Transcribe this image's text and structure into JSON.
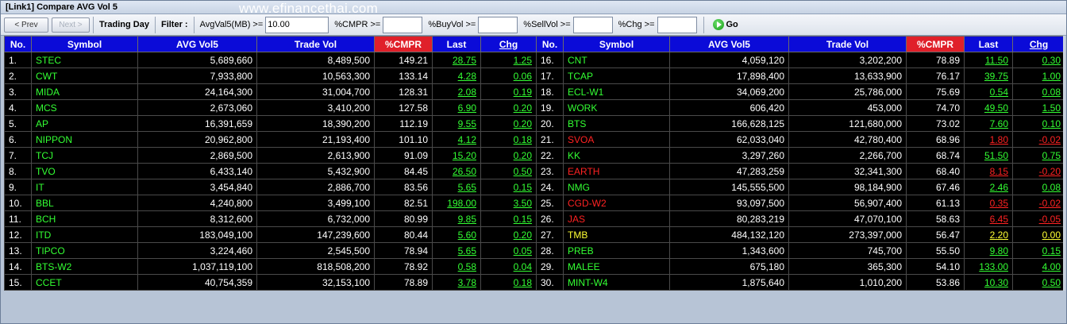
{
  "title": "[Link1] Compare AVG Vol 5",
  "watermark": "www.efinancethai.com",
  "toolbar": {
    "prev_label": "< Prev",
    "next_label": "Next >",
    "trading_day": "Trading Day",
    "filter_label": "Filter :",
    "avgvol_label": "AvgVal5(MB) >=",
    "avgvol_value": "10.00",
    "cmpr_label": "%CMPR >=",
    "cmpr_value": "",
    "buyvol_label": "%BuyVol >=",
    "buyvol_value": "",
    "sellvol_label": "%SellVol >=",
    "sellvol_value": "",
    "chg_label": "%Chg >=",
    "chg_value": "",
    "go_label": "Go"
  },
  "headers": [
    "No.",
    "Symbol",
    "AVG Vol5",
    "Trade Vol",
    "%CMPR",
    "Last",
    "Chg"
  ],
  "colors": {
    "header_bg": "#0b0bd8",
    "cmpr_bg": "#e0202a",
    "up": "#33ff33",
    "down": "#ff2222",
    "flat": "#ffff33"
  },
  "rows": [
    {
      "no": "1.",
      "sym": "STEC",
      "avg": "5,689,660",
      "vol": "8,489,500",
      "cmpr": "149.21",
      "last": "28.75",
      "chg": "1.25",
      "c": "g"
    },
    {
      "no": "2.",
      "sym": "CWT",
      "avg": "7,933,800",
      "vol": "10,563,300",
      "cmpr": "133.14",
      "last": "4.28",
      "chg": "0.06",
      "c": "g"
    },
    {
      "no": "3.",
      "sym": "MIDA",
      "avg": "24,164,300",
      "vol": "31,004,700",
      "cmpr": "128.31",
      "last": "2.08",
      "chg": "0.19",
      "c": "g"
    },
    {
      "no": "4.",
      "sym": "MCS",
      "avg": "2,673,060",
      "vol": "3,410,200",
      "cmpr": "127.58",
      "last": "6.90",
      "chg": "0.20",
      "c": "g"
    },
    {
      "no": "5.",
      "sym": "AP",
      "avg": "16,391,659",
      "vol": "18,390,200",
      "cmpr": "112.19",
      "last": "9.55",
      "chg": "0.20",
      "c": "g"
    },
    {
      "no": "6.",
      "sym": "NIPPON",
      "avg": "20,962,800",
      "vol": "21,193,400",
      "cmpr": "101.10",
      "last": "4.12",
      "chg": "0.18",
      "c": "g"
    },
    {
      "no": "7.",
      "sym": "TCJ",
      "avg": "2,869,500",
      "vol": "2,613,900",
      "cmpr": "91.09",
      "last": "15.20",
      "chg": "0.20",
      "c": "g"
    },
    {
      "no": "8.",
      "sym": "TVO",
      "avg": "6,433,140",
      "vol": "5,432,900",
      "cmpr": "84.45",
      "last": "26.50",
      "chg": "0.50",
      "c": "g"
    },
    {
      "no": "9.",
      "sym": "IT",
      "avg": "3,454,840",
      "vol": "2,886,700",
      "cmpr": "83.56",
      "last": "5.65",
      "chg": "0.15",
      "c": "g"
    },
    {
      "no": "10.",
      "sym": "BBL",
      "avg": "4,240,800",
      "vol": "3,499,100",
      "cmpr": "82.51",
      "last": "198.00",
      "chg": "3.50",
      "c": "g"
    },
    {
      "no": "11.",
      "sym": "BCH",
      "avg": "8,312,600",
      "vol": "6,732,000",
      "cmpr": "80.99",
      "last": "9.85",
      "chg": "0.15",
      "c": "g"
    },
    {
      "no": "12.",
      "sym": "ITD",
      "avg": "183,049,100",
      "vol": "147,239,600",
      "cmpr": "80.44",
      "last": "5.60",
      "chg": "0.20",
      "c": "g"
    },
    {
      "no": "13.",
      "sym": "TIPCO",
      "avg": "3,224,460",
      "vol": "2,545,500",
      "cmpr": "78.94",
      "last": "5.65",
      "chg": "0.05",
      "c": "g"
    },
    {
      "no": "14.",
      "sym": "BTS-W2",
      "avg": "1,037,119,100",
      "vol": "818,508,200",
      "cmpr": "78.92",
      "last": "0.58",
      "chg": "0.04",
      "c": "g"
    },
    {
      "no": "15.",
      "sym": "CCET",
      "avg": "40,754,359",
      "vol": "32,153,100",
      "cmpr": "78.89",
      "last": "3.78",
      "chg": "0.18",
      "c": "g"
    }
  ],
  "rows2": [
    {
      "no": "16.",
      "sym": "CNT",
      "avg": "4,059,120",
      "vol": "3,202,200",
      "cmpr": "78.89",
      "last": "11.50",
      "chg": "0.30",
      "c": "g"
    },
    {
      "no": "17.",
      "sym": "TCAP",
      "avg": "17,898,400",
      "vol": "13,633,900",
      "cmpr": "76.17",
      "last": "39.75",
      "chg": "1.00",
      "c": "g"
    },
    {
      "no": "18.",
      "sym": "ECL-W1",
      "avg": "34,069,200",
      "vol": "25,786,000",
      "cmpr": "75.69",
      "last": "0.54",
      "chg": "0.08",
      "c": "g"
    },
    {
      "no": "19.",
      "sym": "WORK",
      "avg": "606,420",
      "vol": "453,000",
      "cmpr": "74.70",
      "last": "49.50",
      "chg": "1.50",
      "c": "g"
    },
    {
      "no": "20.",
      "sym": "BTS",
      "avg": "166,628,125",
      "vol": "121,680,000",
      "cmpr": "73.02",
      "last": "7.60",
      "chg": "0.10",
      "c": "g"
    },
    {
      "no": "21.",
      "sym": "SVOA",
      "avg": "62,033,040",
      "vol": "42,780,400",
      "cmpr": "68.96",
      "last": "1.80",
      "chg": "-0.02",
      "c": "r"
    },
    {
      "no": "22.",
      "sym": "KK",
      "avg": "3,297,260",
      "vol": "2,266,700",
      "cmpr": "68.74",
      "last": "51.50",
      "chg": "0.75",
      "c": "g"
    },
    {
      "no": "23.",
      "sym": "EARTH",
      "avg": "47,283,259",
      "vol": "32,341,300",
      "cmpr": "68.40",
      "last": "8.15",
      "chg": "-0.20",
      "c": "r"
    },
    {
      "no": "24.",
      "sym": "NMG",
      "avg": "145,555,500",
      "vol": "98,184,900",
      "cmpr": "67.46",
      "last": "2.46",
      "chg": "0.08",
      "c": "g"
    },
    {
      "no": "25.",
      "sym": "CGD-W2",
      "avg": "93,097,500",
      "vol": "56,907,400",
      "cmpr": "61.13",
      "last": "0.35",
      "chg": "-0.02",
      "c": "r"
    },
    {
      "no": "26.",
      "sym": "JAS",
      "avg": "80,283,219",
      "vol": "47,070,100",
      "cmpr": "58.63",
      "last": "6.45",
      "chg": "-0.05",
      "c": "r"
    },
    {
      "no": "27.",
      "sym": "TMB",
      "avg": "484,132,120",
      "vol": "273,397,000",
      "cmpr": "56.47",
      "last": "2.20",
      "chg": "0.00",
      "c": "y"
    },
    {
      "no": "28.",
      "sym": "PREB",
      "avg": "1,343,600",
      "vol": "745,700",
      "cmpr": "55.50",
      "last": "9.80",
      "chg": "0.15",
      "c": "g"
    },
    {
      "no": "29.",
      "sym": "MALEE",
      "avg": "675,180",
      "vol": "365,300",
      "cmpr": "54.10",
      "last": "133.00",
      "chg": "4.00",
      "c": "g"
    },
    {
      "no": "30.",
      "sym": "MINT-W4",
      "avg": "1,875,640",
      "vol": "1,010,200",
      "cmpr": "53.86",
      "last": "10.30",
      "chg": "0.50",
      "c": "g"
    }
  ]
}
